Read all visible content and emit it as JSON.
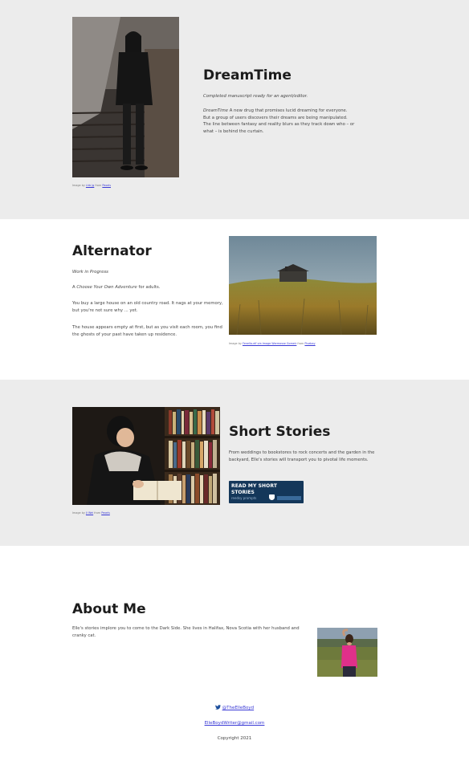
{
  "dreamtime": {
    "title": "DreamTime",
    "status": "Completed manuscript ready for an agent/editor.",
    "desc_title": "DreamTime",
    "desc_body": " A new drug that promises lucid dreaming for everyone. But a group of users discovers their dreams are being manipulated. The line between fantasy and reality blurs as they track down who – or what – is behind the curtain.",
    "credit_prefix": "Image by ",
    "credit_author": "Lhb jg",
    "credit_mid": " from ",
    "credit_source": "Pexels"
  },
  "alternator": {
    "title": "Alternator",
    "status": "Work in Progress",
    "cyoa_prefix": "A ",
    "cyoa_em": "Choose Your Own Adventure",
    "cyoa_suffix": " for adults.",
    "para1": "You buy a large house on an old country road. It nags at your memory, but you're not sure why ... yet.",
    "para2": "The house appears empty at first, but as you visit each room, you find the ghosts of your past have taken up residence.",
    "credit_prefix": "Image by ",
    "credit_author": "Fenella-elf via Image Warmosse Gomeir",
    "credit_mid": " from ",
    "credit_source": "Pixabay"
  },
  "short_stories": {
    "title": "Short Stories",
    "desc": "From weddings to bookstores to rock concerts and the garden in the backyard, Elle's stories will transport you to pivotal life moments.",
    "button_line1": "READ MY SHORT",
    "button_line2": "STORIES",
    "button_line3": "reedsy prompts",
    "credit_prefix": "Image by ",
    "credit_author": "Ji Wei",
    "credit_mid": " from ",
    "credit_source": "Pexels"
  },
  "about": {
    "title": "About Me",
    "bio": "Elle's stories implore you to come to the Dark Side. She lives in Halifax, Nova Scotia with her husband and cranky cat."
  },
  "footer": {
    "twitter_handle": "@TheElleBoyd",
    "email": "ElleBoydWriter@gmail.com",
    "copyright": "Copyright 2021"
  },
  "colors": {
    "section_gray": "#ececec",
    "link": "#3a3ad6",
    "button_bg": "#14375a",
    "twitter": "#1da1f2"
  }
}
